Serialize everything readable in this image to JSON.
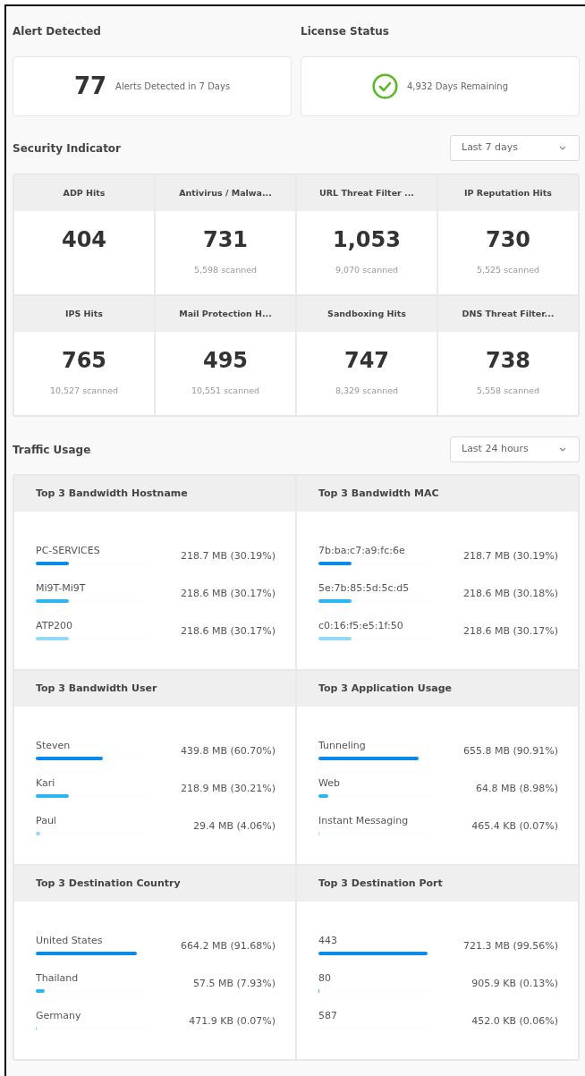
{
  "alert_detected": {
    "title": "Alert Detected",
    "count": "77",
    "caption": "Alerts Detected in 7 Days"
  },
  "license_status": {
    "title": "License Status",
    "valid": true,
    "caption": "4,932 Days Remaining"
  },
  "security_indicator": {
    "title": "Security Indicator",
    "range": "Last 7 days",
    "metrics": [
      {
        "name": "ADP Hits",
        "value": "404"
      },
      {
        "name": "Antivirus / Malwa...",
        "value": "731",
        "scanned": "5,598 scanned"
      },
      {
        "name": "URL Threat Filter ...",
        "value": "1,053",
        "scanned": "9,070 scanned"
      },
      {
        "name": "IP Reputation Hits",
        "value": "730",
        "scanned": "5,525 scanned"
      },
      {
        "name": "IPS Hits",
        "value": "765",
        "scanned": "10,527 scanned"
      },
      {
        "name": "Mail Protection H...",
        "value": "495",
        "scanned": "10,551 scanned"
      },
      {
        "name": "Sandboxing Hits",
        "value": "747",
        "scanned": "8,329 scanned"
      },
      {
        "name": "DNS Threat Filter...",
        "value": "738",
        "scanned": "5,558 scanned"
      }
    ]
  },
  "traffic_usage": {
    "title": "Traffic Usage",
    "range": "Last 24 hours",
    "panels": [
      {
        "title": "Top 3 Bandwidth Hostname",
        "rows": [
          {
            "label": "PC-SERVICES",
            "value": "218.7 MB (30.19%)",
            "level": 0.3019,
            "color": "#0a8be8"
          },
          {
            "label": "Mi9T-Mi9T",
            "value": "218.6 MB (30.17%)",
            "level": 0.3017,
            "color": "#2bb6f2"
          },
          {
            "label": "ATP200",
            "value": "218.6 MB (30.17%)",
            "level": 0.3017,
            "color": "#93d8f6"
          }
        ]
      },
      {
        "title": "Top 3 Bandwidth MAC",
        "rows": [
          {
            "label": "7b:ba:c7:a9:fc:6e",
            "value": "218.7 MB (30.19%)",
            "level": 0.3019,
            "color": "#0a8be8"
          },
          {
            "label": "5e:7b:85:5d:5c:d5",
            "value": "218.6 MB (30.18%)",
            "level": 0.3018,
            "color": "#2bb6f2"
          },
          {
            "label": "c0:16:f5:e5:1f:50",
            "value": "218.6 MB (30.17%)",
            "level": 0.3017,
            "color": "#93d8f6"
          }
        ]
      },
      {
        "title": "Top 3 Bandwidth User",
        "rows": [
          {
            "label": "Steven",
            "value": "439.8 MB (60.70%)",
            "level": 0.607,
            "color": "#0a8be8"
          },
          {
            "label": "Kari",
            "value": "218.9 MB (30.21%)",
            "level": 0.3021,
            "color": "#2bb6f2"
          },
          {
            "label": "Paul",
            "value": "29.4 MB (4.06%)",
            "level": 0.0406,
            "color": "#93d8f6"
          }
        ]
      },
      {
        "title": "Top 3 Application Usage",
        "rows": [
          {
            "label": "Tunneling",
            "value": "655.8 MB (90.91%)",
            "level": 0.9091,
            "color": "#0a8be8"
          },
          {
            "label": "Web",
            "value": "64.8 MB (8.98%)",
            "level": 0.0898,
            "color": "#2bb6f2"
          },
          {
            "label": "Instant Messaging",
            "value": "465.4 KB (0.07%)",
            "level": 0.0007,
            "color": "#93d8f6"
          }
        ]
      },
      {
        "title": "Top 3 Destination Country",
        "rows": [
          {
            "label": "United States",
            "value": "664.2 MB (91.68%)",
            "level": 0.9168,
            "color": "#0a8be8"
          },
          {
            "label": "Thailand",
            "value": "57.5 MB (7.93%)",
            "level": 0.0793,
            "color": "#2bb6f2"
          },
          {
            "label": "Germany",
            "value": "471.9 KB (0.07%)",
            "level": 0.0007,
            "color": "#93d8f6"
          }
        ]
      },
      {
        "title": "Top 3 Destination Port",
        "rows": [
          {
            "label": "443",
            "value": "721.3 MB (99.56%)",
            "level": 0.9956,
            "color": "#0a8be8"
          },
          {
            "label": "80",
            "value": "905.9 KB (0.13%)",
            "level": 0.0013,
            "color": "#2bb6f2"
          },
          {
            "label": "587",
            "value": "452.0 KB (0.06%)",
            "level": 0.0006
          }
        ]
      }
    ]
  }
}
